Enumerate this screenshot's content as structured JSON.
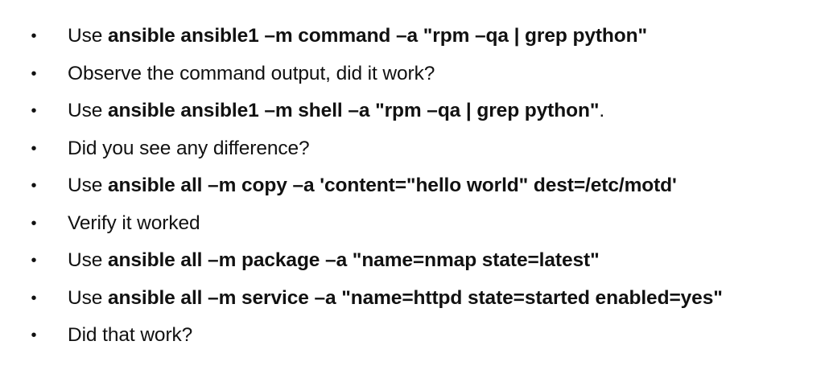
{
  "slide": {
    "bullet_glyph": "•",
    "items": [
      {
        "plain": "Use ",
        "bold": "ansible ansible1 –m command –a \"rpm –qa | grep python\"",
        "tail": ""
      },
      {
        "plain": "Observe the command output, did it work?",
        "bold": "",
        "tail": ""
      },
      {
        "plain": "Use ",
        "bold": "ansible ansible1 –m shell –a \"rpm –qa | grep python\"",
        "tail": "."
      },
      {
        "plain": "Did you see any difference?",
        "bold": "",
        "tail": ""
      },
      {
        "plain": "Use ",
        "bold": "ansible all –m copy –a 'content=\"hello world\" dest=/etc/motd'",
        "tail": ""
      },
      {
        "plain": "Verify it worked",
        "bold": "",
        "tail": ""
      },
      {
        "plain": "Use ",
        "bold": "ansible all –m package –a \"name=nmap state=latest\"",
        "tail": ""
      },
      {
        "plain": "Use ",
        "bold": "ansible all –m service –a \"name=httpd state=started enabled=yes\"",
        "tail": ""
      },
      {
        "plain": "Did that work?",
        "bold": "",
        "tail": ""
      }
    ]
  }
}
